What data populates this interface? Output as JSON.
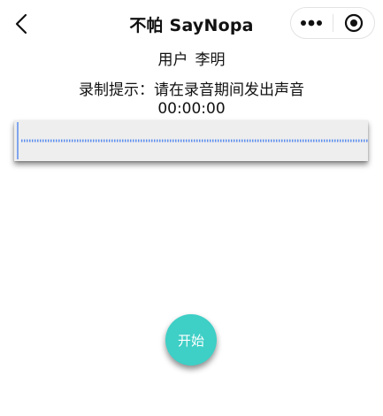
{
  "nav": {
    "title": "不帕 SayNopa",
    "back_icon": "chevron-left-icon",
    "more_icon": "more-dots-icon",
    "close_icon": "target-close-icon"
  },
  "user": {
    "label": "用户",
    "name": "李明"
  },
  "recording": {
    "hint": "录制提示：请在录音期间发出声音",
    "timer": "00:00:00",
    "wave_color": "#5b8def"
  },
  "controls": {
    "start_label": "开始",
    "start_color": "#3ecfc6"
  }
}
